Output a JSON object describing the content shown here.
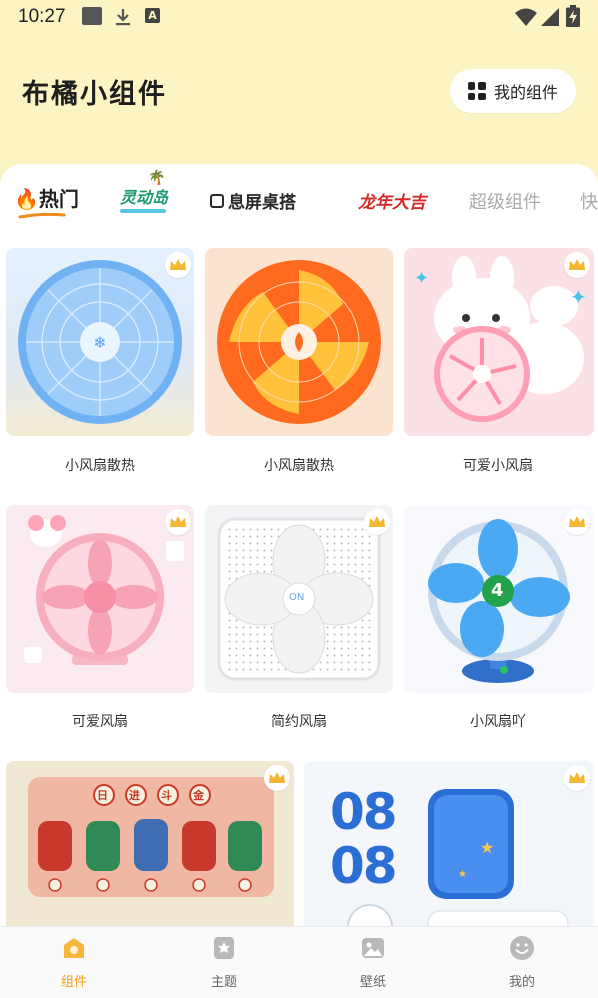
{
  "status_bar": {
    "time": "10:27",
    "a_badge": "A"
  },
  "header": {
    "title": "布橘小组件",
    "my_widgets_label": "我的组件"
  },
  "tabs": [
    {
      "label": "热门",
      "active": true
    },
    {
      "label": "灵动岛"
    },
    {
      "label": "息屏桌搭"
    },
    {
      "label": "龙年大吉"
    },
    {
      "label": "超级组件"
    },
    {
      "label": "快"
    }
  ],
  "colors": {
    "accent": "#f0a014",
    "header_bg": "#fdf4c4",
    "vip_gold": "#f5b731"
  },
  "cards": [
    {
      "label": "小风扇散热",
      "vip": true,
      "icon": "blue-fan-snowflake"
    },
    {
      "label": "小风扇散热",
      "vip": false,
      "icon": "orange-fan-flame"
    },
    {
      "label": "可爱小风扇",
      "vip": true,
      "icon": "bunny-pink-fan"
    },
    {
      "label": "可爱风扇",
      "vip": true,
      "icon": "pink-bow-fan"
    },
    {
      "label": "简约风扇",
      "vip": true,
      "icon": "white-box-fan",
      "on_text": "ON"
    },
    {
      "label": "小风扇吖",
      "vip": true,
      "icon": "blue-desk-fan",
      "speed": "4"
    },
    {
      "label": "",
      "vip": true,
      "icon": "fortune-gods",
      "chars": [
        "日",
        "进",
        "斗",
        "金"
      ]
    },
    {
      "label": "",
      "vip": true,
      "icon": "clock-widget",
      "time_top": "08",
      "time_bottom": "08"
    }
  ],
  "bottom_nav": [
    {
      "label": "组件",
      "icon": "widget-icon",
      "active": true
    },
    {
      "label": "主题",
      "icon": "theme-icon"
    },
    {
      "label": "壁纸",
      "icon": "wallpaper-icon"
    },
    {
      "label": "我的",
      "icon": "profile-icon"
    }
  ]
}
